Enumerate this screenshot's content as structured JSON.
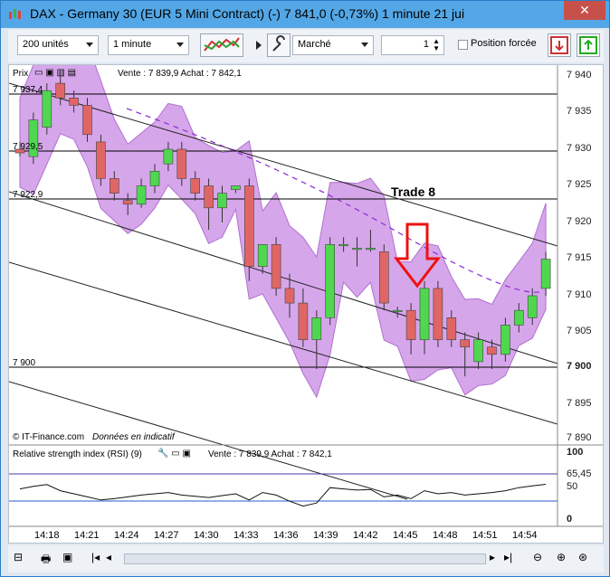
{
  "window": {
    "title": "DAX - Germany 30 (EUR 5 Mini Contract) (-)    7 841,0 (-0,73%)    1 minute  21 jui",
    "close_label": "✕"
  },
  "toolbar": {
    "units_value": "200 unités",
    "timeframe_value": "1 minute",
    "order_type_value": "Marché",
    "quantity_value": "1",
    "forced_position_label": "Position forcée"
  },
  "price_panel": {
    "header_label": "Prix",
    "quote_text": "Vente : 7 839,9 Achat : 7 842,1",
    "y_ticks": [
      "7 940",
      "7 935",
      "7 930",
      "7 925",
      "7 920",
      "7 915",
      "7 910",
      "7 905",
      "7 900",
      "7 895",
      "7 890"
    ],
    "level_labels": [
      "7 937,4",
      "7 929,5",
      "7 922,9",
      "7 900"
    ],
    "annotation": "Trade 8",
    "footer_source": "© IT-Finance.com",
    "footer_note": "Données en indicatif"
  },
  "rsi_panel": {
    "header_label": "Relative strength index (RSI) (9)",
    "quote_text": "Vente : 7 839,9 Achat : 7 842,1",
    "y_ticks": [
      "100",
      "65,45",
      "50",
      "0"
    ]
  },
  "time_axis": [
    "14:18",
    "14:21",
    "14:24",
    "14:27",
    "14:30",
    "14:33",
    "14:36",
    "14:39",
    "14:42",
    "14:45",
    "14:48",
    "14:51",
    "14:54"
  ],
  "colors": {
    "bull": "#4fd84f",
    "bear": "#e06666",
    "band": "#d6a6ea",
    "arrow": "#ee1111"
  },
  "chart_data": {
    "type": "candlestick",
    "ylim": [
      7890,
      7940
    ],
    "candles": [
      {
        "o": 7930,
        "h": 7931,
        "l": 7929,
        "c": 7929.5
      },
      {
        "o": 7929,
        "h": 7935,
        "l": 7928,
        "c": 7934
      },
      {
        "o": 7933,
        "h": 7939,
        "l": 7932,
        "c": 7938
      },
      {
        "o": 7939,
        "h": 7940,
        "l": 7936,
        "c": 7937
      },
      {
        "o": 7937,
        "h": 7938,
        "l": 7935,
        "c": 7936
      },
      {
        "o": 7936,
        "h": 7937,
        "l": 7931,
        "c": 7932
      },
      {
        "o": 7931,
        "h": 7932,
        "l": 7925,
        "c": 7926
      },
      {
        "o": 7926,
        "h": 7927,
        "l": 7923,
        "c": 7924
      },
      {
        "o": 7923,
        "h": 7924,
        "l": 7921,
        "c": 7922.5
      },
      {
        "o": 7922.5,
        "h": 7926,
        "l": 7922,
        "c": 7925
      },
      {
        "o": 7925,
        "h": 7928,
        "l": 7924,
        "c": 7927
      },
      {
        "o": 7928,
        "h": 7931,
        "l": 7927,
        "c": 7930
      },
      {
        "o": 7930,
        "h": 7931,
        "l": 7925,
        "c": 7926
      },
      {
        "o": 7926,
        "h": 7927,
        "l": 7923,
        "c": 7924
      },
      {
        "o": 7925,
        "h": 7926,
        "l": 7919,
        "c": 7922
      },
      {
        "o": 7922,
        "h": 7925,
        "l": 7920,
        "c": 7924
      },
      {
        "o": 7924.5,
        "h": 7925,
        "l": 7924,
        "c": 7925
      },
      {
        "o": 7925,
        "h": 7926,
        "l": 7912,
        "c": 7914
      },
      {
        "o": 7914,
        "h": 7916,
        "l": 7913,
        "c": 7917
      },
      {
        "o": 7917,
        "h": 7918,
        "l": 7910,
        "c": 7911
      },
      {
        "o": 7911,
        "h": 7913,
        "l": 7907,
        "c": 7909
      },
      {
        "o": 7909,
        "h": 7911,
        "l": 7903,
        "c": 7904
      },
      {
        "o": 7904,
        "h": 7908,
        "l": 7900,
        "c": 7907
      },
      {
        "o": 7907,
        "h": 7918,
        "l": 7906,
        "c": 7917
      },
      {
        "o": 7917,
        "h": 7918,
        "l": 7916,
        "c": 7917
      },
      {
        "o": 7916.5,
        "h": 7918,
        "l": 7914,
        "c": 7916.5
      },
      {
        "o": 7916.5,
        "h": 7919,
        "l": 7916,
        "c": 7916.5
      },
      {
        "o": 7916,
        "h": 7917,
        "l": 7908,
        "c": 7909
      },
      {
        "o": 7908,
        "h": 7908.5,
        "l": 7907,
        "c": 7908
      },
      {
        "o": 7908,
        "h": 7909,
        "l": 7902,
        "c": 7904
      },
      {
        "o": 7904,
        "h": 7912,
        "l": 7902,
        "c": 7911
      },
      {
        "o": 7911,
        "h": 7912,
        "l": 7903,
        "c": 7904
      },
      {
        "o": 7907,
        "h": 7908,
        "l": 7903,
        "c": 7904
      },
      {
        "o": 7904,
        "h": 7905,
        "l": 7899,
        "c": 7903
      },
      {
        "o": 7901,
        "h": 7905,
        "l": 7900,
        "c": 7904
      },
      {
        "o": 7903,
        "h": 7904,
        "l": 7900,
        "c": 7902
      },
      {
        "o": 7902,
        "h": 7907,
        "l": 7901,
        "c": 7906
      },
      {
        "o": 7906,
        "h": 7909,
        "l": 7905,
        "c": 7908
      },
      {
        "o": 7907,
        "h": 7911,
        "l": 7906,
        "c": 7910
      },
      {
        "o": 7911,
        "h": 7916,
        "l": 7910,
        "c": 7915
      }
    ],
    "rsi": [
      58,
      62,
      65,
      55,
      50,
      45,
      40,
      42,
      45,
      48,
      50,
      52,
      48,
      46,
      44,
      47,
      50,
      40,
      52,
      48,
      38,
      30,
      35,
      60,
      58,
      56,
      57,
      45,
      48,
      42,
      55,
      50,
      52,
      48,
      50,
      52,
      55,
      60,
      63,
      65.45
    ]
  }
}
